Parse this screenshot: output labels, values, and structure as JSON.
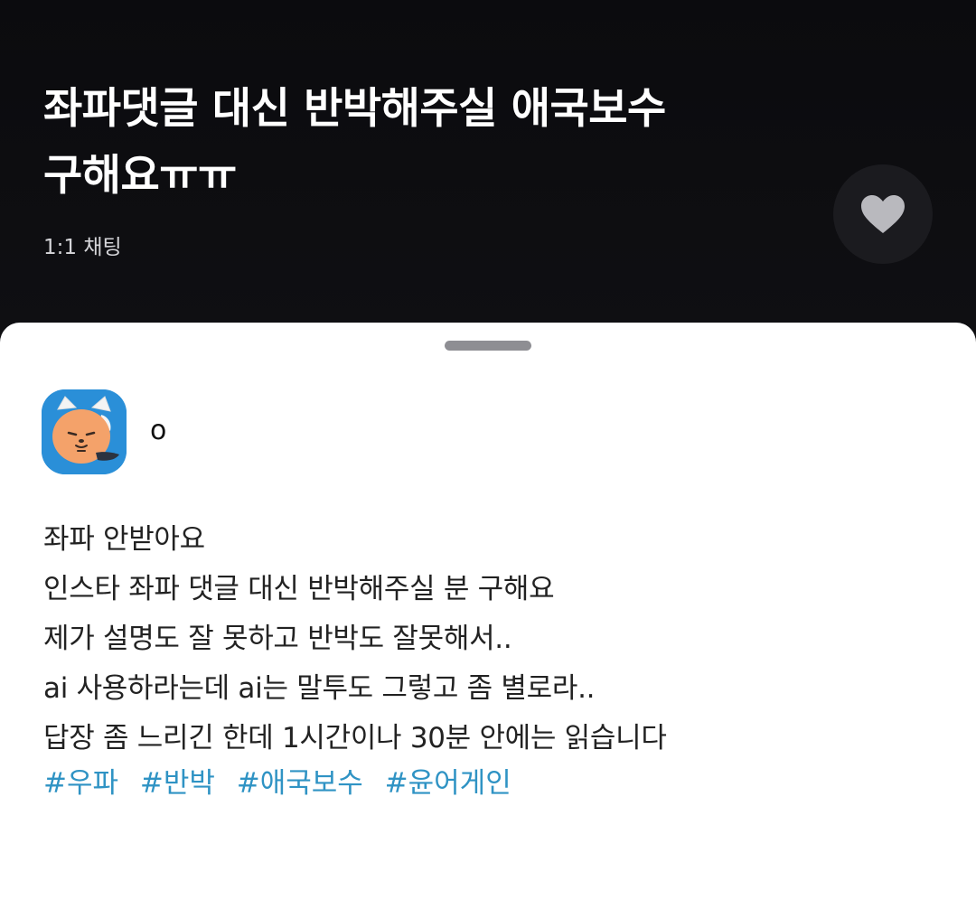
{
  "header": {
    "title_line1": "좌파댓글 대신 반박해주실 애국보수",
    "title_line2": "구해요ㅠㅠ",
    "chat_type": "1:1 채팅",
    "like_icon": "heart-icon"
  },
  "post": {
    "username": "o",
    "avatar_icon": "cat-character-avatar",
    "lines": [
      "좌파 안받아요",
      "인스타 좌파 댓글 대신 반박해주실 분 구해요",
      "제가 설명도 잘 못하고 반박도 잘못해서..",
      "ai 사용하라는데 ai는 말투도 그렇고 좀 별로라..",
      "답장 좀 느리긴 한데 1시간이나 30분 안에는 읽습니다"
    ],
    "tags": [
      "#우파",
      "#반박",
      "#애국보수",
      "#윤어게인"
    ]
  },
  "colors": {
    "header_bg": "#0f0f12",
    "sheet_bg": "#ffffff",
    "tag": "#2f93c4",
    "avatar_bg": "#2a8fd8"
  }
}
